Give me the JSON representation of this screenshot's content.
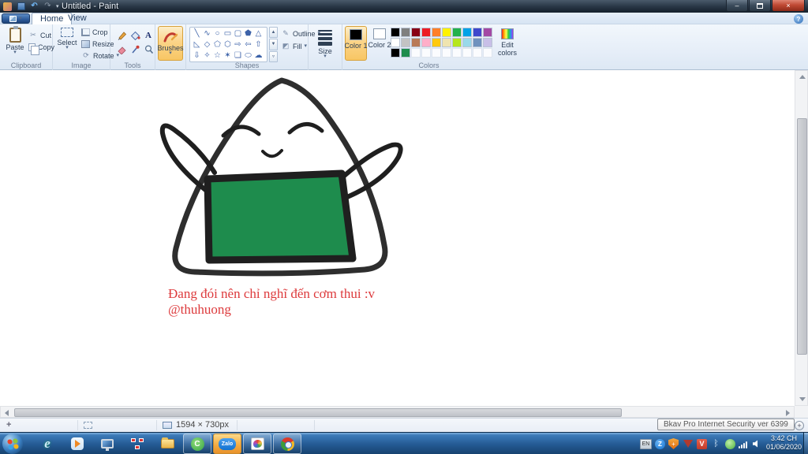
{
  "window": {
    "title": "Untitled - Paint",
    "controls": [
      "minimize-button",
      "maximize-button",
      "close-button"
    ]
  },
  "quick_access": {
    "icons": [
      "paint-app-icon",
      "save-icon",
      "undo-icon",
      "redo-icon",
      "customize-dropdown-icon"
    ]
  },
  "tabs": [
    {
      "label": "Home",
      "active": true
    },
    {
      "label": "View",
      "active": false
    }
  ],
  "ribbon": {
    "clipboard": {
      "label": "Clipboard",
      "paste": "Paste",
      "cut": "Cut",
      "copy": "Copy"
    },
    "image": {
      "label": "Image",
      "select": "Select",
      "crop": "Crop",
      "resize": "Resize",
      "rotate": "Rotate"
    },
    "tools": {
      "label": "Tools",
      "icons": [
        "pencil-icon",
        "fill-bucket-icon",
        "text-tool-icon",
        "eraser-icon",
        "color-picker-icon",
        "magnifier-icon"
      ]
    },
    "brushes": {
      "label": "Brushes",
      "selected": true
    },
    "shapes": {
      "label": "Shapes",
      "outline": "Outline",
      "fill": "Fill",
      "items": [
        {
          "name": "line",
          "glyph": "╲"
        },
        {
          "name": "curve",
          "glyph": "∿"
        },
        {
          "name": "ellipse",
          "glyph": "○"
        },
        {
          "name": "rectangle",
          "glyph": "▭"
        },
        {
          "name": "rounded-rectangle",
          "glyph": "▢"
        },
        {
          "name": "polygon",
          "glyph": "⬟"
        },
        {
          "name": "triangle",
          "glyph": "△"
        },
        {
          "name": "right-triangle",
          "glyph": "◺"
        },
        {
          "name": "diamond",
          "glyph": "◇"
        },
        {
          "name": "pentagon",
          "glyph": "⬠"
        },
        {
          "name": "hexagon",
          "glyph": "⬡"
        },
        {
          "name": "right-arrow",
          "glyph": "⇨"
        },
        {
          "name": "left-arrow",
          "glyph": "⇦"
        },
        {
          "name": "up-arrow",
          "glyph": "⇧"
        },
        {
          "name": "down-arrow",
          "glyph": "⇩"
        },
        {
          "name": "four-point-star",
          "glyph": "✧"
        },
        {
          "name": "five-point-star",
          "glyph": "☆"
        },
        {
          "name": "six-point-star",
          "glyph": "✶"
        },
        {
          "name": "rounded-callout",
          "glyph": "❏"
        },
        {
          "name": "oval-callout",
          "glyph": "⬭"
        },
        {
          "name": "cloud-callout",
          "glyph": "☁"
        }
      ]
    },
    "size": {
      "label": "Size"
    },
    "colors": {
      "label": "Colors",
      "color1": "Color 1",
      "color2": "Color 2",
      "edit": "Edit colors",
      "color1_value": "#000000",
      "color2_value": "#ffffff",
      "palette_row1": [
        "#000000",
        "#7F7F7F",
        "#880015",
        "#ED1C24",
        "#FF7F27",
        "#FFF200",
        "#22B14C",
        "#00A2E8",
        "#3F48CC",
        "#A349A4"
      ],
      "palette_row2": [
        "#FFFFFF",
        "#C3C3C3",
        "#B97A57",
        "#FFAEC9",
        "#FFC90E",
        "#EFE4B0",
        "#B5E61D",
        "#99D9EA",
        "#7092BE",
        "#C8BFE7"
      ],
      "recent": [
        "#000000",
        "#1E8C4D"
      ],
      "empty_cells": 8
    }
  },
  "canvas": {
    "drawing": "hand-drawn onigiri rice-ball character with raised arms, closed happy eyes and green nori band",
    "ink": "#1f1f1f",
    "nori_fill": "#1e8c4d",
    "text_line1": "Đang đói nên chỉ nghĩ đến cơm thui :v",
    "text_line2": "@thuhuong",
    "text_color": "#dd3a3c"
  },
  "status": {
    "image_size": "1594 × 730px",
    "tooltip": "Bkav Pro Internet Security ver 6399",
    "icons": [
      "cursor-position-icon",
      "selection-size-icon",
      "image-size-icon",
      "zoom-slider",
      "zoom-in-button"
    ]
  },
  "taskbar": {
    "pinned": [
      "start-button",
      "internet-explorer",
      "windows-media-player",
      "remote-desktop",
      "network-tool",
      "windows-explorer",
      "coccoc-browser",
      "zalo",
      "paint",
      "chrome-browser"
    ],
    "zalo_label": "Zalo",
    "coccoc_label": "C",
    "tray": [
      "language-indicator",
      "zalo-tray",
      "bkav-shield",
      "app-triangle",
      "v-app",
      "bluetooth",
      "green-swirl",
      "network-signal",
      "volume"
    ],
    "tray_language": "EN",
    "tray_v": "V",
    "clock": {
      "time": "3:42 CH",
      "date": "01/06/2020"
    }
  }
}
